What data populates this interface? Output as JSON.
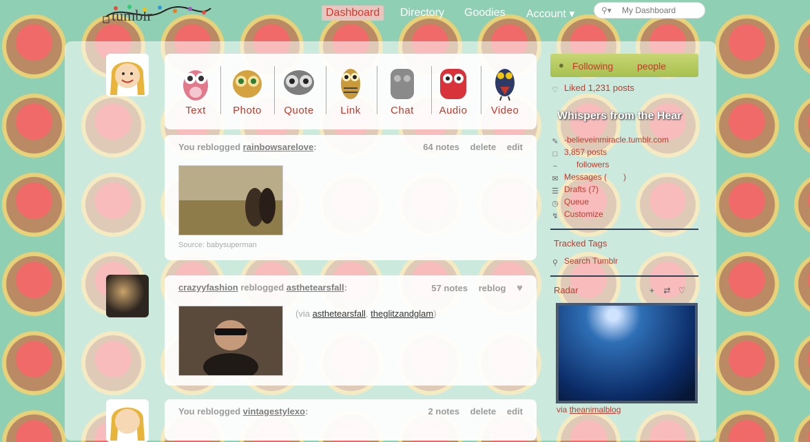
{
  "nav": {
    "items": [
      "Dashboard",
      "Directory",
      "Goodies",
      "Account"
    ],
    "account_caret": "▾",
    "search_placeholder": "My Dashboard"
  },
  "post_types": [
    "Text",
    "Photo",
    "Quote",
    "Link",
    "Chat",
    "Audio",
    "Video"
  ],
  "posts": [
    {
      "header_prefix": "You reblogged",
      "header_user": "rainbowsarelove",
      "header_suffix": ":",
      "notes": "64 notes",
      "action1": "delete",
      "action2": "edit",
      "source": "Source: babysuperman"
    },
    {
      "header_user": "crazyyfashion",
      "header_mid": "reblogged",
      "header_user2": "asthetearsfall",
      "header_suffix": ":",
      "notes": "57 notes",
      "action1": "reblog",
      "via_open": "(via",
      "via_user1": "asthetearsfall",
      "via_sep": ",",
      "via_user2": "theglitzandglam",
      "via_close": ")"
    },
    {
      "header_prefix": "You reblogged",
      "header_user": "vintagestylexo",
      "header_suffix": ":",
      "notes": "2 notes",
      "action1": "delete",
      "action2": "edit"
    }
  ],
  "sidebar": {
    "following_label": "Following",
    "following_people": "people",
    "liked": "Liked 1,231 posts",
    "blog_title": "Whispers from the Hear",
    "blog_url": "-believeinmiracle.tumblr.com",
    "posts_count": "3,857 posts",
    "followers": "followers",
    "messages": "Messages (",
    "messages_close": ")",
    "drafts": "Drafts (7)",
    "queue": "Queue",
    "customize": "Customize",
    "tracked_tags": "Tracked Tags",
    "search_tumblr": "Search Tumblr",
    "radar": "Radar",
    "radar_via": "via",
    "radar_user": "theanimalblog"
  },
  "colors": {
    "accent": "#c0392b",
    "background": "#8fcfb4"
  }
}
